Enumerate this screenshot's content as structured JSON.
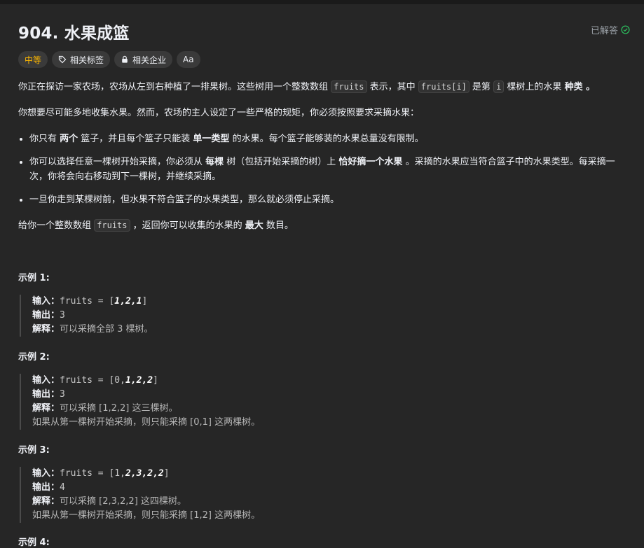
{
  "problem": {
    "title": "904. 水果成篮",
    "solved_label": "已解答",
    "tags": {
      "difficulty": "中等",
      "related_topics": "相关标签",
      "companies": "相关企业",
      "font_toggle": "Aa"
    }
  },
  "description": {
    "p1": {
      "a": "你正在探访一家农场，农场从左到右种植了一排果树。这些树用一个整数数组 ",
      "code1": "fruits",
      "b": " 表示，其中 ",
      "code2": "fruits[i]",
      "c": " 是第 ",
      "code3": "i",
      "d": " 棵树上的水果 ",
      "bold": "种类",
      "e": " 。"
    },
    "p2": "你想要尽可能多地收集水果。然而，农场的主人设定了一些严格的规矩，你必须按照要求采摘水果：",
    "rule1": {
      "a": "你只有 ",
      "b1": "两个",
      "c": " 篮子，并且每个篮子只能装 ",
      "b2": "单一类型",
      "d": " 的水果。每个篮子能够装的水果总量没有限制。"
    },
    "rule2": {
      "a": "你可以选择任意一棵树开始采摘，你必须从 ",
      "b1": "每棵",
      "c": " 树（包括开始采摘的树）上 ",
      "b2": "恰好摘一个水果",
      "d": " 。采摘的水果应当符合篮子中的水果类型。每采摘一次，你将会向右移动到下一棵树，并继续采摘。"
    },
    "rule3": "一旦你走到某棵树前，但水果不符合篮子的水果类型，那么就必须停止采摘。",
    "p3": {
      "a": "给你一个整数数组 ",
      "code": "fruits",
      "b": " ，返回你可以收集的水果的 ",
      "bold": "最大",
      "c": " 数目。"
    }
  },
  "examples": [
    {
      "title": "示例 1:",
      "input_label": "输入：",
      "input_pre": "fruits = [",
      "input_em": "1,2,1",
      "input_post": "]",
      "output_label": "输出：",
      "output": "3",
      "explain_label": "解释：",
      "explain": "可以采摘全部 3 棵树。",
      "extra": ""
    },
    {
      "title": "示例 2:",
      "input_label": "输入：",
      "input_pre": "fruits = [0,",
      "input_em": "1,2,2",
      "input_post": "]",
      "output_label": "输出：",
      "output": "3",
      "explain_label": "解释：",
      "explain": "可以采摘 [1,2,2] 这三棵树。",
      "extra": "如果从第一棵树开始采摘，则只能采摘 [0,1] 这两棵树。"
    },
    {
      "title": "示例 3:",
      "input_label": "输入：",
      "input_pre": "fruits = [1,",
      "input_em": "2,3,2,2",
      "input_post": "]",
      "output_label": "输出：",
      "output": "4",
      "explain_label": "解释：",
      "explain": "可以采摘 [2,3,2,2] 这四棵树。",
      "extra": "如果从第一棵树开始采摘，则只能采摘 [1,2] 这两棵树。"
    }
  ],
  "example4_title": "示例 4:",
  "colors": {
    "background": "#262626",
    "text": "#eff1f6",
    "difficulty": "#ffb800",
    "tag_bg": "#3a3a3a"
  }
}
